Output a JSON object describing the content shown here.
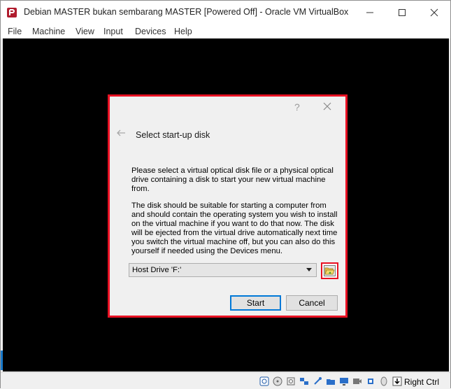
{
  "window": {
    "title": "Debian MASTER bukan sembarang MASTER [Powered Off] - Oracle VM VirtualBox",
    "controls": {
      "minimize_icon": "minimize-icon",
      "maximize_icon": "maximize-icon",
      "close_icon": "close-icon"
    }
  },
  "menu": {
    "items": [
      {
        "label": "File"
      },
      {
        "label": "Machine"
      },
      {
        "label": "View"
      },
      {
        "label": "Input"
      },
      {
        "label": "Devices"
      },
      {
        "label": "Help"
      }
    ]
  },
  "dialog": {
    "help_label": "?",
    "heading": "Select start-up disk",
    "paragraph1": "Please select a virtual optical disk file or a physical optical drive containing a disk to start your new virtual machine from.",
    "paragraph2": "The disk should be suitable for starting a computer from and should contain the operating system you wish to install on the virtual machine if you want to do that now. The disk will be ejected from the virtual drive automatically next time you switch the virtual machine off, but you can also do this yourself if needed using the Devices menu.",
    "disk_select": {
      "selected": "Host Drive 'F:'"
    },
    "start_label": "Start",
    "cancel_label": "Cancel",
    "highlight_color": "#e81123"
  },
  "statusbar": {
    "host_key": "Right Ctrl",
    "icons": [
      "hard-disk-icon",
      "optical-drive-icon",
      "audio-icon",
      "network-icon",
      "usb-icon",
      "shared-folders-icon",
      "display-icon",
      "video-capture-icon",
      "cpu-icon",
      "mouse-integration-icon",
      "host-key-arrow-icon"
    ]
  }
}
